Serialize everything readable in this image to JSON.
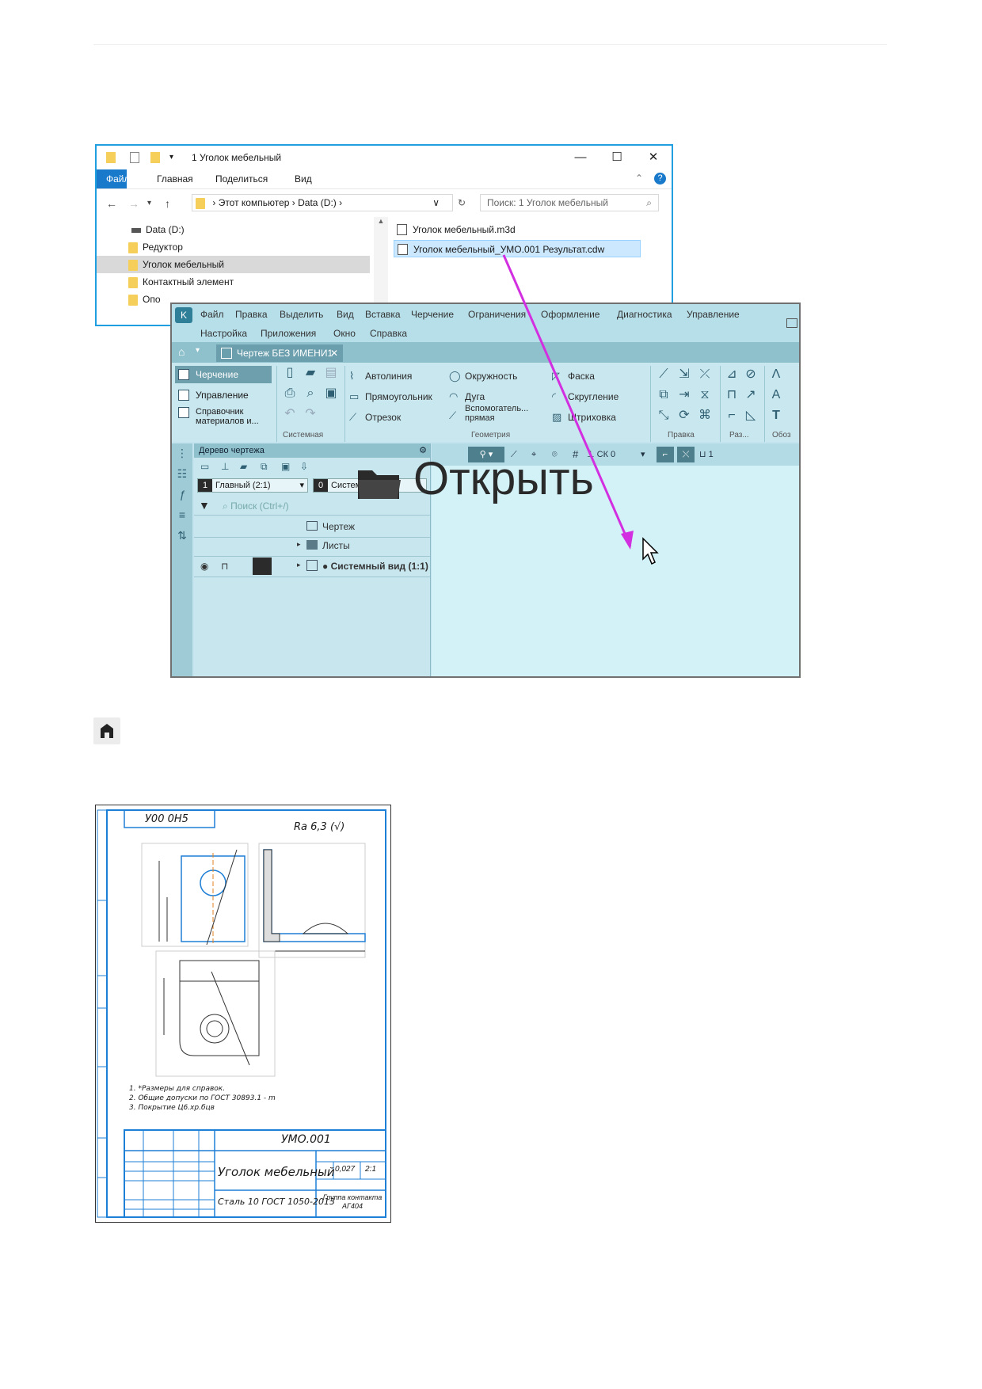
{
  "explorer": {
    "title": "1 Уголок мебельный",
    "ribbon_tabs": [
      "Файл",
      "Главная",
      "Поделиться",
      "Вид"
    ],
    "address": {
      "path": [
        "Этот компьютер",
        "Data (D:)"
      ],
      "search_placeholder": "Поиск: 1 Уголок мебельный"
    },
    "tree": [
      "Data (D:)",
      "Редуктор",
      "Уголок мебельный",
      "Контактный элемент",
      "Опо"
    ],
    "files": [
      "Уголок мебельный.m3d",
      "Уголок мебельный_УМО.001 Результат.cdw"
    ]
  },
  "kompas": {
    "menu_row1": [
      "Файл",
      "Правка",
      "Выделить",
      "Вид",
      "Вставка",
      "Черчение",
      "Ограничения",
      "Оформление",
      "Диагностика",
      "Управление"
    ],
    "menu_row2": [
      "Настройка",
      "Приложения",
      "Окно",
      "Справка"
    ],
    "doc_tab": "Чертеж БЕЗ ИМЕНИ1",
    "left_items": [
      "Черчение",
      "Управление",
      "Справочник материалов и..."
    ],
    "section_labels": [
      "Системная",
      "Геометрия",
      "Правка",
      "Раз...",
      "Обоз"
    ],
    "geometry_tools": [
      "Автолиния",
      "Прямоугольник",
      "Отрезок",
      "Окружность",
      "Дуга",
      "Вспомогатель... прямая",
      "Фаска",
      "Скругление",
      "Штриховка"
    ],
    "tree_panel": {
      "title": "Дерево чертежа",
      "view_combo": "Главный (2:1)",
      "view_num": "1",
      "layer_num": "0",
      "layer_combo": "Системный слой",
      "search_placeholder": "Поиск (Ctrl+/)",
      "rows": [
        "Чертеж",
        "Листы",
        "● Системный вид (1:1)"
      ]
    },
    "viewbar": {
      "cs": "СК 0",
      "scale": "1"
    }
  },
  "overlay_text": "Открыть",
  "drawing": {
    "roughness": "Ra 6,3 (√)",
    "stamp_top": "У00 0Н5",
    "notes": [
      "1. *Размеры для справок.",
      "2. Общие допуски по ГОСТ 30893.1 - m",
      "3. Покрытие Ц6.хр.бцв"
    ],
    "designation": "УМО.001",
    "name": "Уголок мебельный",
    "material": "Сталь 10 ГОСТ 1050-2013",
    "mass": "0,027",
    "scale": "2:1",
    "org": "Группа контакта АГ404"
  },
  "colors": {
    "accent": "#1979ca",
    "kompas_bg": "#c3e4ee",
    "arrow": "#d22fe0"
  }
}
